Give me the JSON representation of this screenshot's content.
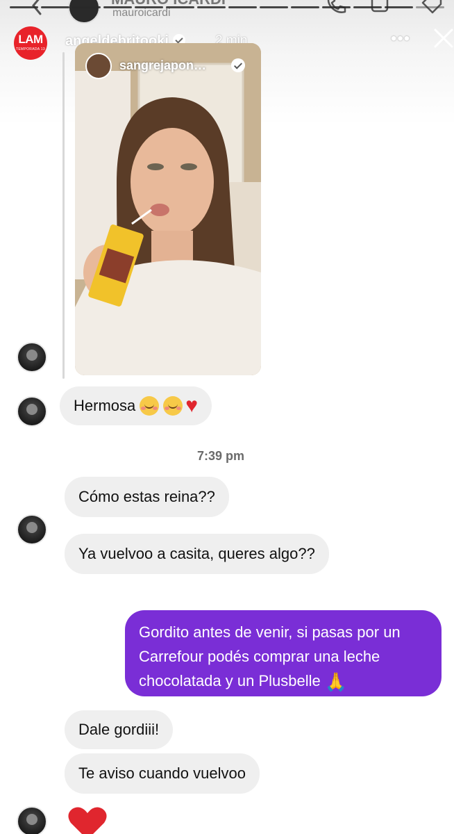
{
  "story": {
    "progress_segments": 14,
    "progress_done": 13,
    "brand_logo": {
      "text": "LAM",
      "subtext": "TEMPORADA 13"
    },
    "username": "angeldebritooki",
    "time": "2 min",
    "more_icon": "more-horizontal-icon",
    "close_icon": "close-icon"
  },
  "dm": {
    "contact_name": "MAURO ICARDI",
    "contact_handle": "mauroicardi",
    "back_icon": "chevron-left-icon",
    "call_icon": "phone-icon",
    "video_icon": "video-icon",
    "tag_icon": "tag-icon"
  },
  "shared_post": {
    "username": "sangrejapon…",
    "verified": true
  },
  "messages": [
    {
      "id": "m1",
      "text": "Hermosa",
      "emojis": [
        "smiling-face-with-hearts",
        "smiling-face-with-hearts",
        "red-heart"
      ]
    },
    {
      "id": "m2",
      "text": "Cómo estas reina??"
    },
    {
      "id": "m3",
      "text": "Ya vuelvoo a casita, queres algo??"
    },
    {
      "id": "m4",
      "text": "Gordito antes de venir, si pasas por un Carrefour podés comprar una leche chocolatada y un Plusbelle",
      "emoji": "folded-hands",
      "sent": true
    },
    {
      "id": "m5",
      "text": "Dale gordiii!"
    },
    {
      "id": "m6",
      "text": "Te aviso cuando vuelvoo"
    },
    {
      "id": "m7",
      "emoji": "red-heart-reaction"
    }
  ],
  "timestamp": "7:39 pm",
  "colors": {
    "sent_bubble": "#7a2ed6",
    "received_bubble": "#efefef",
    "lam_red": "#e8232a",
    "heart_red": "#e0262e"
  }
}
